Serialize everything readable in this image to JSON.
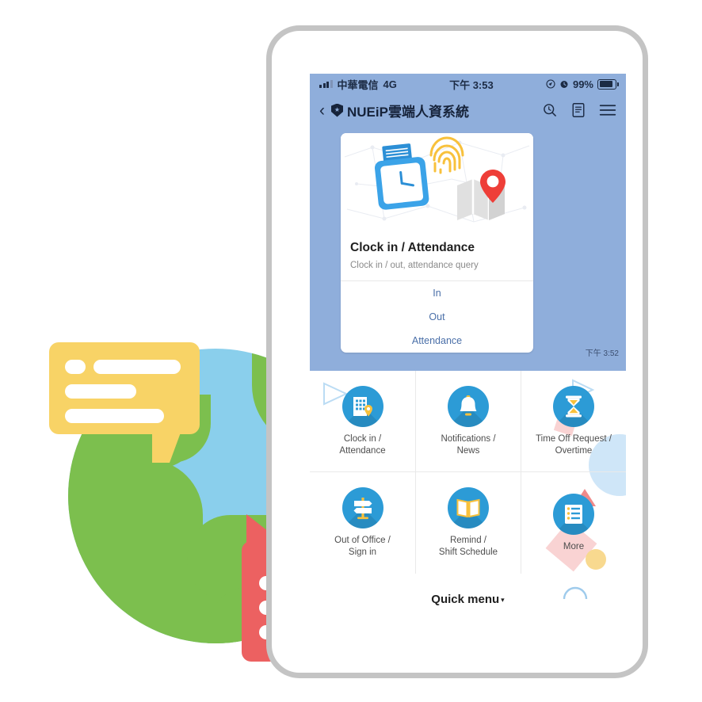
{
  "status_bar": {
    "carrier": "中華電信",
    "network": "4G",
    "time": "下午 3:53",
    "battery_percent": "99%",
    "icons": [
      "signal-bars-icon",
      "location-icon",
      "alarm-icon",
      "battery-icon"
    ]
  },
  "app_header": {
    "back_glyph": "‹",
    "brand": "NUEiP雲端人資系統",
    "actions": [
      "search-clock-icon",
      "document-icon",
      "hamburger-menu-icon"
    ]
  },
  "chat": {
    "card": {
      "title": "Clock in / Attendance",
      "subtitle": "Clock in / out, attendance query",
      "actions": [
        "In",
        "Out",
        "Attendance"
      ],
      "illustration": [
        "punch-clock-icon",
        "fingerprint-icon",
        "map-pin-icon"
      ]
    },
    "message_time": "下午 3:52"
  },
  "menu": {
    "items": [
      {
        "label": "Clock in /\nAttendance",
        "icon": "building-location-icon"
      },
      {
        "label": "Notifications /\nNews",
        "icon": "bell-icon"
      },
      {
        "label": "Time Off Request /\nOvertime",
        "icon": "hourglass-icon"
      },
      {
        "label": "Out of Office /\nSign in",
        "icon": "signpost-icon"
      },
      {
        "label": "Remind /\nShift Schedule",
        "icon": "open-book-icon"
      },
      {
        "label": "More",
        "icon": "list-icon"
      }
    ],
    "quick_menu_label": "Quick menu",
    "quick_menu_caret": "▾"
  },
  "colors": {
    "chat_background": "#8FAEDB",
    "icon_circle": "#2C9BD6",
    "accent_yellow": "#F8C13C",
    "link_blue": "#4A6FA8",
    "globe_ocean": "#8ACFEC",
    "globe_land": "#7CBF4E",
    "bubble_yellow": "#F8D366",
    "bubble_red": "#EC6161",
    "tablet_frame": "#C4C4C4"
  }
}
